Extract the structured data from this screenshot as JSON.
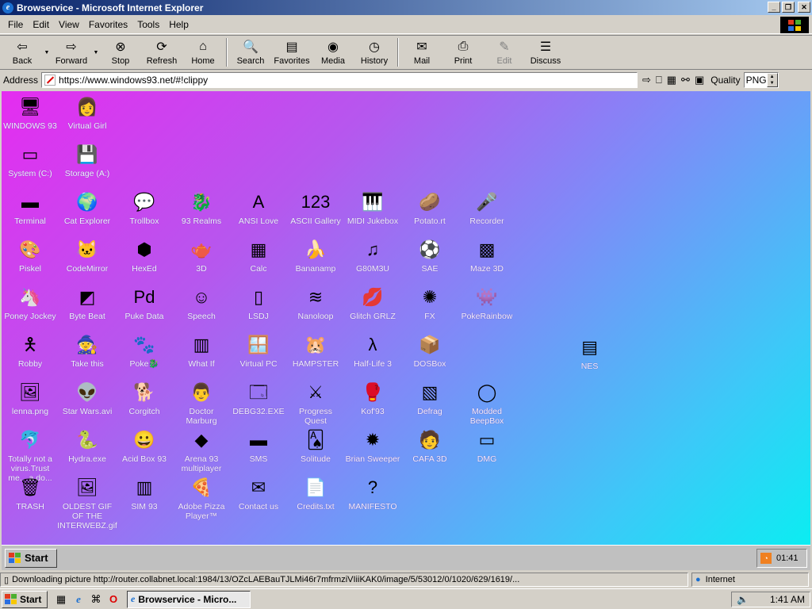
{
  "window": {
    "title": "Browservice - Microsoft Internet Explorer",
    "min_label": "_",
    "max_label": "❐",
    "close_label": "✕"
  },
  "menu": [
    "File",
    "Edit",
    "View",
    "Favorites",
    "Tools",
    "Help"
  ],
  "toolbar": {
    "back": "Back",
    "forward": "Forward",
    "stop": "Stop",
    "refresh": "Refresh",
    "home": "Home",
    "search": "Search",
    "favorites": "Favorites",
    "media": "Media",
    "history": "History",
    "mail": "Mail",
    "print": "Print",
    "edit": "Edit",
    "discuss": "Discuss"
  },
  "address": {
    "label": "Address",
    "url": "https://www.windows93.net/#!clippy",
    "quality_label": "Quality",
    "quality_value": "PNG"
  },
  "desktop": {
    "icons": [
      {
        "label": "WINDOWS 93",
        "icon": "computer-icon"
      },
      {
        "label": "Virtual Girl",
        "icon": "virtual-girl-icon"
      },
      {
        "label": "System (C:)",
        "icon": "drive-icon"
      },
      {
        "label": "Storage (A:)",
        "icon": "floppy-icon"
      },
      {
        "label": "Terminal",
        "icon": "terminal-icon"
      },
      {
        "label": "Cat Explorer",
        "icon": "globe-icon"
      },
      {
        "label": "Trollbox",
        "icon": "chat-icon"
      },
      {
        "label": "93 Realms",
        "icon": "realms-icon"
      },
      {
        "label": "ANSI Love",
        "icon": "ansi-icon"
      },
      {
        "label": "ASCII Gallery",
        "icon": "ascii-icon"
      },
      {
        "label": "MIDI Jukebox",
        "icon": "piano-icon"
      },
      {
        "label": "Potato.rt",
        "icon": "potato-icon"
      },
      {
        "label": "Recorder",
        "icon": "microphone-icon"
      },
      {
        "label": "Piskel",
        "icon": "palette-icon"
      },
      {
        "label": "CodeMirror",
        "icon": "codemirror-icon"
      },
      {
        "label": "HexEd",
        "icon": "cube-icon"
      },
      {
        "label": "3D",
        "icon": "teapot-icon"
      },
      {
        "label": "Calc",
        "icon": "calculator-icon"
      },
      {
        "label": "Bananamp",
        "icon": "banana-icon"
      },
      {
        "label": "G80M3U",
        "icon": "playlist-icon"
      },
      {
        "label": "SAE",
        "icon": "amiga-ball-icon"
      },
      {
        "label": "Maze 3D",
        "icon": "maze-icon"
      },
      {
        "label": "Poney Jockey",
        "icon": "pony-icon"
      },
      {
        "label": "Byte Beat",
        "icon": "bytebeat-icon"
      },
      {
        "label": "Puke Data",
        "icon": "pd-icon"
      },
      {
        "label": "Speech",
        "icon": "face-icon"
      },
      {
        "label": "LSDJ",
        "icon": "lsdj-icon"
      },
      {
        "label": "Nanoloop",
        "icon": "wave-icon"
      },
      {
        "label": "Glitch GRLZ",
        "icon": "lips-icon"
      },
      {
        "label": "FX",
        "icon": "fx-icon"
      },
      {
        "label": "PokeRainbow",
        "icon": "pokerainbow-icon"
      },
      {
        "label": "Robby",
        "icon": "stickman-icon"
      },
      {
        "label": "Take this",
        "icon": "take-this-icon"
      },
      {
        "label": "Poke🐉",
        "icon": "poke-icon"
      },
      {
        "label": "What If",
        "icon": "whatif-icon"
      },
      {
        "label": "Virtual PC",
        "icon": "virtual-pc-icon"
      },
      {
        "label": "HAMPSTER",
        "icon": "hamster-icon"
      },
      {
        "label": "Half-Life 3",
        "icon": "halflife-icon"
      },
      {
        "label": "DOSBox",
        "icon": "dosbox-icon"
      },
      {
        "label": "NES",
        "icon": "nes-icon"
      },
      {
        "label": "lenna.png",
        "icon": "image-file-icon"
      },
      {
        "label": "Star Wars.avi",
        "icon": "yoda-icon"
      },
      {
        "label": "Corgitch",
        "icon": "corgi-icon"
      },
      {
        "label": "Doctor Marburg",
        "icon": "doctor-icon"
      },
      {
        "label": "DEBG32.EXE",
        "icon": "debug-icon"
      },
      {
        "label": "Progress Quest",
        "icon": "swords-icon"
      },
      {
        "label": "Kof'93",
        "icon": "fighter-icon"
      },
      {
        "label": "Defrag",
        "icon": "defrag-icon"
      },
      {
        "label": "Modded BeepBox",
        "icon": "beepbox-icon"
      },
      {
        "label": "Totally not a virus.Trust me... a do...",
        "icon": "dolphin-icon"
      },
      {
        "label": "Hydra.exe",
        "icon": "hydra-icon"
      },
      {
        "label": "Acid Box 93",
        "icon": "smiley-icon"
      },
      {
        "label": "Arena 93 multiplayer",
        "icon": "arena-icon"
      },
      {
        "label": "SMS",
        "icon": "sms-icon"
      },
      {
        "label": "Solitude",
        "icon": "solitude-icon"
      },
      {
        "label": "Brian Sweeper",
        "icon": "mine-icon"
      },
      {
        "label": "CAFA 3D",
        "icon": "cafa-icon"
      },
      {
        "label": "DMG",
        "icon": "dmg-icon"
      },
      {
        "label": "TRASH",
        "icon": "trash-icon"
      },
      {
        "label": "OLDEST GIF OF THE INTERWEBZ.gif",
        "icon": "gif-file-icon"
      },
      {
        "label": "SIM 93",
        "icon": "sim-icon"
      },
      {
        "label": "Adobe Pizza Player™",
        "icon": "pizza-icon"
      },
      {
        "label": "Contact us",
        "icon": "contact-icon"
      },
      {
        "label": "Credits.txt",
        "icon": "text-file-icon"
      },
      {
        "label": "MANIFESTO",
        "icon": "question-icon"
      }
    ]
  },
  "inner_taskbar": {
    "start": "Start",
    "time": "01:41"
  },
  "status": {
    "text": "Downloading picture http://router.collabnet.local:1984/13/OZcLAEBauTJLMi46r7mfrmziVIiiKAK0/image/5/53012/0/1020/629/1619/...",
    "zone": "Internet"
  },
  "os_taskbar": {
    "start": "Start",
    "app": "Browservice - Micro...",
    "time": "1:41 AM"
  }
}
